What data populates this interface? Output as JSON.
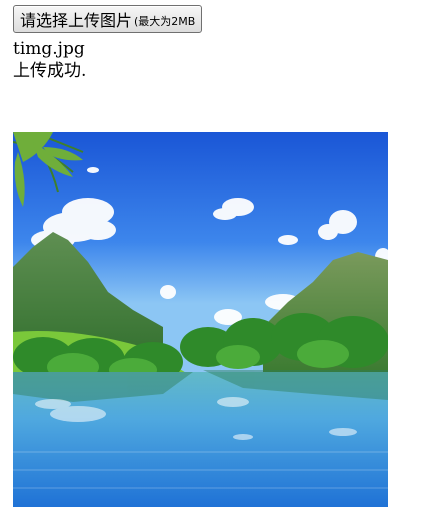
{
  "upload": {
    "button_label": "请选择上传图片",
    "size_note": "(最大为2MB"
  },
  "file": {
    "name": "timg.jpg",
    "status": "上传成功."
  },
  "preview": {
    "icon": "landscape-image"
  }
}
